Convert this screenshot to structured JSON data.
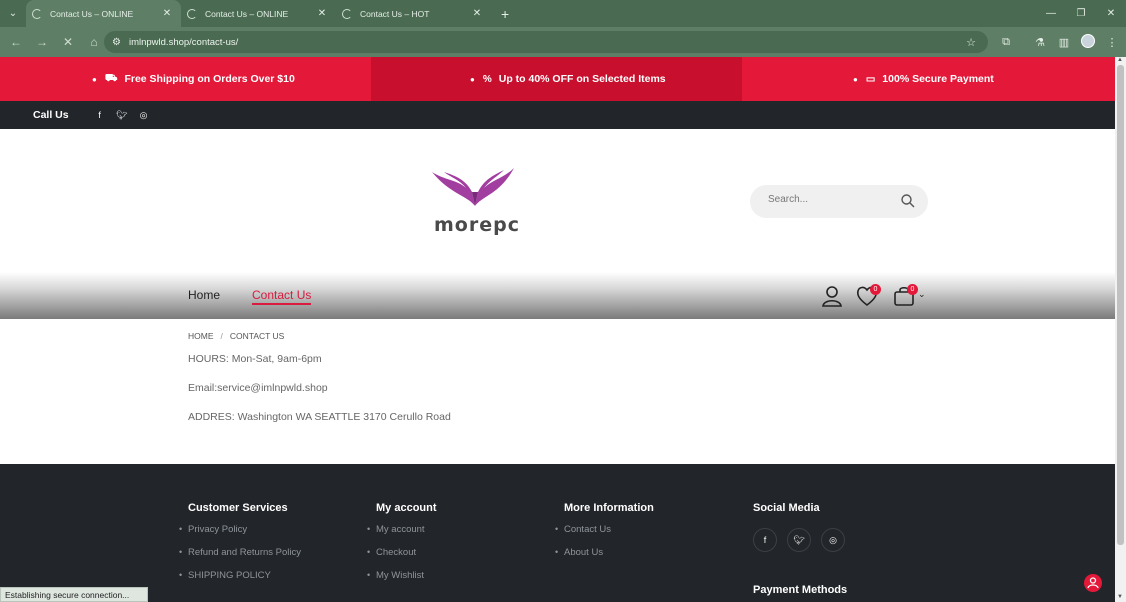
{
  "browser": {
    "tabs": [
      {
        "title": "Contact Us – ONLINE",
        "active": true
      },
      {
        "title": "Contact Us – ONLINE",
        "active": false
      },
      {
        "title": "Contact Us – HOT",
        "active": false
      }
    ],
    "url": "imlnpwld.shop/contact-us/",
    "status_text": "Establishing secure connection..."
  },
  "promo": {
    "items": [
      {
        "text": "Free Shipping on Orders Over $10",
        "icon": "truck-icon"
      },
      {
        "text": "Up to 40% OFF on Selected Items",
        "icon": "percent-icon"
      },
      {
        "text": "100% Secure Payment",
        "icon": "card-icon"
      }
    ]
  },
  "topbar": {
    "call_label": "Call Us",
    "social": [
      "facebook-icon",
      "twitter-icon",
      "instagram-icon"
    ]
  },
  "header": {
    "logo_text": "morepc",
    "search_placeholder": "Search..."
  },
  "nav": {
    "items": [
      {
        "label": "Home",
        "active": false
      },
      {
        "label": "Contact Us",
        "active": true
      }
    ],
    "wishlist_count": "0",
    "cart_count": "0"
  },
  "breadcrumb": {
    "home": "HOME",
    "current": "CONTACT US"
  },
  "contact": {
    "hours": "HOURS: Mon-Sat, 9am-6pm",
    "email": "Email:service@imlnpwld.shop",
    "address": "ADDRES: Washington WA SEATTLE 3170 Cerullo Road"
  },
  "footer": {
    "customer_services": {
      "title": "Customer Services",
      "links": [
        "Privacy Policy",
        "Refund and Returns Policy",
        "SHIPPING POLICY"
      ]
    },
    "my_account": {
      "title": "My account",
      "links": [
        "My account",
        "Checkout",
        "My Wishlist"
      ]
    },
    "more_information": {
      "title": "More Information",
      "links": [
        "Contact Us",
        "About Us"
      ]
    },
    "social_media": {
      "title": "Social Media"
    },
    "payment_methods": {
      "title": "Payment Methods"
    }
  },
  "colors": {
    "accent": "#e4193a",
    "promo_dark": "#c8102e",
    "dark": "#222529",
    "browser": "#4a6b52"
  }
}
